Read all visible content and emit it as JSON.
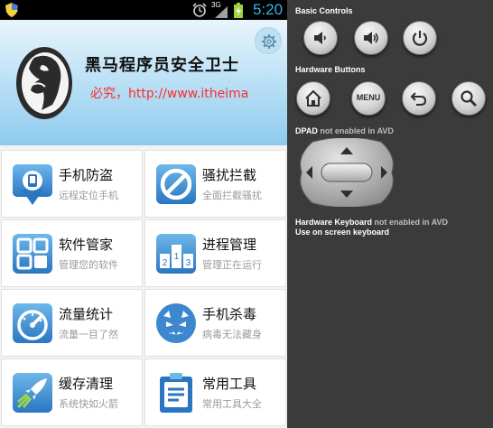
{
  "status_bar": {
    "network": "3G",
    "time": "5:20",
    "time_color": "#33b5e5",
    "icons": [
      "shield-icon",
      "alarm-icon",
      "signal-icon",
      "battery-charging-icon"
    ]
  },
  "header": {
    "title": "黑马程序员安全卫士",
    "marquee": "版权所有，必究，http://www.itheima.com",
    "marquee_visible": "版必究，http://www.itheima",
    "marquee_color": "#ff2a2a",
    "settings_icon": "gear-icon"
  },
  "tiles": [
    {
      "title": "手机防盗",
      "desc": "远程定位手机",
      "icon": "location-pin-icon"
    },
    {
      "title": "骚扰拦截",
      "desc": "全面拦截骚扰",
      "icon": "block-icon"
    },
    {
      "title": "软件管家",
      "desc": "管理您的软件",
      "icon": "apps-grid-icon"
    },
    {
      "title": "进程管理",
      "desc": "管理正在运行",
      "icon": "process-icon"
    },
    {
      "title": "流量统计",
      "desc": "流量一目了然",
      "icon": "speedometer-icon"
    },
    {
      "title": "手机杀毒",
      "desc": "病毒无法藏身",
      "icon": "virus-monster-icon"
    },
    {
      "title": "缓存清理",
      "desc": "系统快如火箭",
      "icon": "rocket-icon"
    },
    {
      "title": "常用工具",
      "desc": "常用工具大全",
      "icon": "toolbox-icon"
    }
  ],
  "emulator": {
    "basic_controls_label": "Basic Controls",
    "hardware_buttons_label": "Hardware Buttons",
    "menu_label": "MENU",
    "dpad_label": "DPAD",
    "dpad_status": "not enabled in AVD",
    "keyboard_label": "Hardware Keyboard",
    "keyboard_status": "not enabled in AVD",
    "keyboard_hint": "Use on screen keyboard",
    "basic_buttons": [
      "volume-down-icon",
      "volume-up-icon",
      "power-icon"
    ],
    "hardware_buttons": [
      "home-icon",
      "menu-button",
      "back-icon",
      "search-icon"
    ]
  }
}
